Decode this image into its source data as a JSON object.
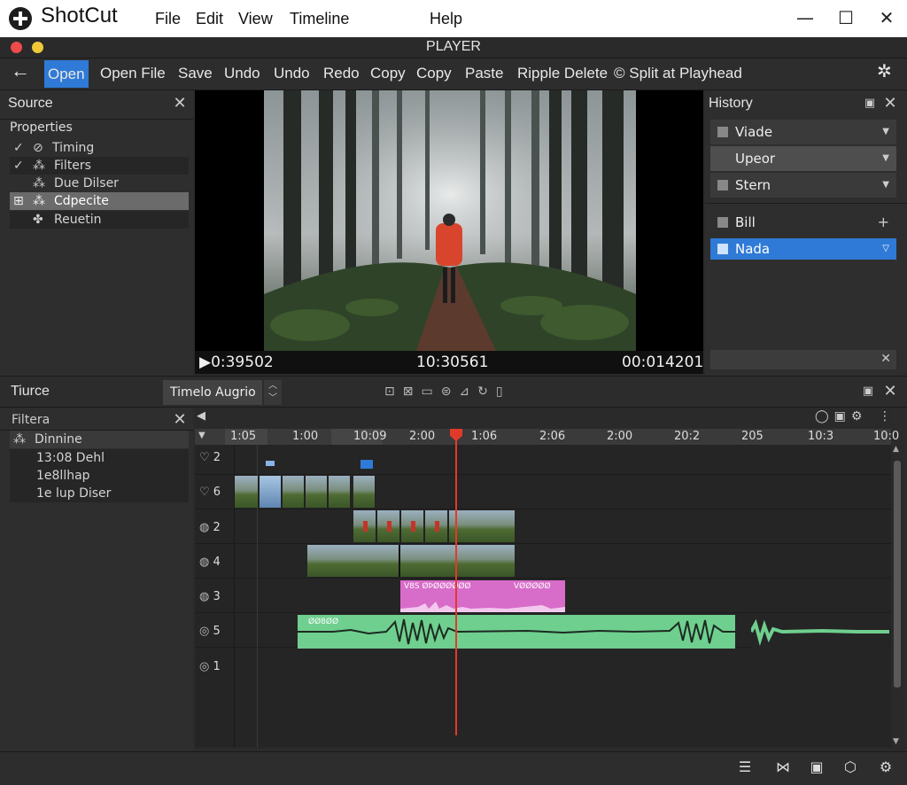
{
  "app": {
    "name": "ShotCut"
  },
  "menu": [
    "File",
    "Edit",
    "View",
    "Timeline",
    "Help"
  ],
  "player": {
    "title": "PLAYER"
  },
  "toolbar": {
    "items": [
      "Open",
      "Open File",
      "Save",
      "Undo",
      "Undo",
      "Redo",
      "Copy",
      "Copy",
      "Paste",
      "Ripple Delete",
      "© Split at Playhead"
    ]
  },
  "source": {
    "title": "Source",
    "properties_label": "Properties",
    "items": [
      "Timing",
      "Filters",
      "Due Dilser",
      "Cdpecite",
      "Reuetin"
    ]
  },
  "history": {
    "title": "History",
    "dropdowns": [
      "Viade",
      "Upeor",
      "Stern"
    ],
    "list": [
      "Bill",
      "Nada"
    ]
  },
  "timecodes": {
    "current": "▶0:39502",
    "middle": "10:30561",
    "duration": "00:014201"
  },
  "lower_left": {
    "title": "Tiurce",
    "filters_title": "Filtera",
    "items": [
      "Dinnine",
      "13:08 Dehl",
      "1e8llhap",
      "1e lup Diser"
    ]
  },
  "timeline": {
    "tab_label": "Timelo Augrio",
    "ruler": [
      "1:05",
      "1:00",
      "10:09",
      "2:00",
      "1:06",
      "2:06",
      "2:00",
      "20:2",
      "205",
      "10:3",
      "10:0"
    ],
    "tracks": [
      "2",
      "6",
      "2",
      "4",
      "3",
      "5",
      "1"
    ],
    "clip_labels": {
      "pink1": "V8S ØÞØØØØØØ",
      "pink2": "VØØØØØ",
      "green1": "ØØ8ØØ"
    }
  },
  "colors": {
    "accent": "#2f7ad6",
    "playhead": "#e23a2a",
    "video_clip": "#5d7a8e",
    "audio_pink": "#d86cc9",
    "audio_green": "#6fcf8f"
  },
  "icons": {
    "back": "left-arrow-icon",
    "settings": "gear-icon"
  }
}
